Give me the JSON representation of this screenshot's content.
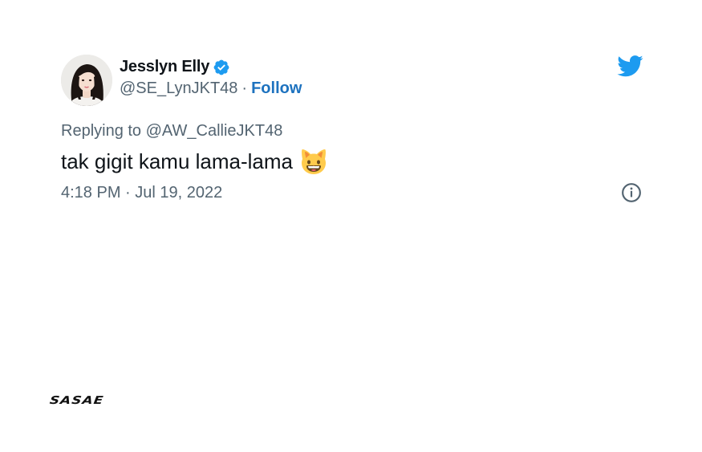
{
  "tweet": {
    "author": {
      "display_name": "Jesslyn Elly",
      "handle": "@SE_LynJKT48",
      "verified": true,
      "avatar": "avatar-photo"
    },
    "separator": "·",
    "follow_label": "Follow",
    "replying_prefix": "Replying to",
    "replying_to": "@AW_CallieJKT48",
    "text": "tak gigit kamu lama-lama",
    "emoji": "smiling-cat-face-icon",
    "timestamp": "4:18 PM · Jul 19, 2022",
    "icons": {
      "platform": "twitter-bird-icon",
      "info": "info-icon",
      "verified": "verified-badge-icon"
    }
  },
  "watermark": {
    "brand": "SASAE"
  },
  "colors": {
    "text_primary": "#0f1419",
    "text_secondary": "#536471",
    "link": "#1d72bf",
    "twitter_blue": "#1d9bf0"
  }
}
